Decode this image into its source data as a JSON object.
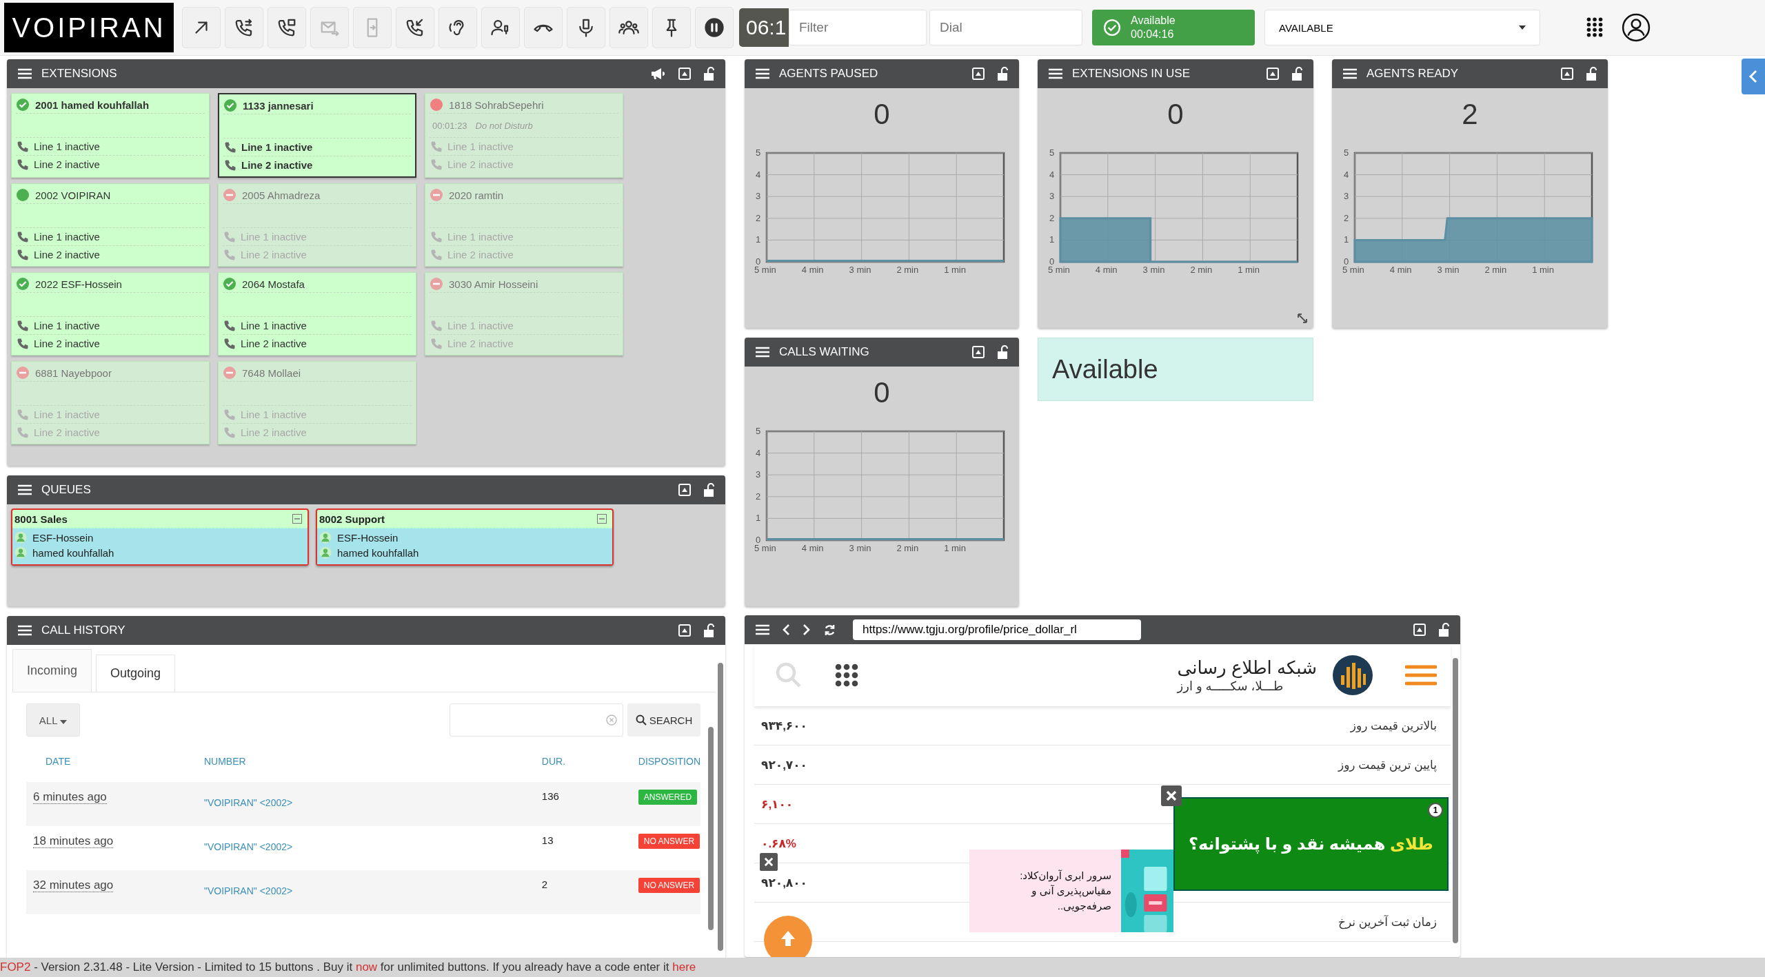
{
  "topbar": {
    "logo": "VOIPIRAN",
    "tools": [
      {
        "kind": "transfer",
        "disabled": false
      },
      {
        "kind": "forward",
        "disabled": false
      },
      {
        "kind": "voicemail",
        "disabled": false
      },
      {
        "kind": "mail",
        "disabled": true
      },
      {
        "kind": "mobile",
        "disabled": true
      },
      {
        "kind": "pickup",
        "disabled": false
      },
      {
        "kind": "listen",
        "disabled": false
      },
      {
        "kind": "whisper",
        "disabled": false
      },
      {
        "kind": "hangup",
        "disabled": false
      },
      {
        "kind": "record",
        "disabled": false
      },
      {
        "kind": "conference",
        "disabled": false
      },
      {
        "kind": "pin",
        "disabled": false
      },
      {
        "kind": "pause",
        "disabled": false
      }
    ],
    "timer": "06:1",
    "filter": {
      "placeholder": "Filter"
    },
    "dial": {
      "placeholder": "Dial"
    },
    "presence": {
      "label": "Available",
      "time": "00:04:16"
    },
    "status_select": "AVAILABLE"
  },
  "extensions": {
    "title": "EXTENSIONS",
    "cards": [
      {
        "name": "2001 hamed kouhfallah",
        "kind": "check",
        "active": true,
        "bold": true,
        "selected": false,
        "lines": [
          "Line 1 inactive",
          "Line 2 inactive"
        ]
      },
      {
        "name": "1133 jannesari",
        "kind": "check",
        "active": true,
        "bold": true,
        "selected": true,
        "lines": [
          "Line 1 inactive",
          "Line 2 inactive"
        ]
      },
      {
        "name": "1818 SohrabSepehri",
        "kind": "dot-red",
        "active": false,
        "bold": false,
        "selected": false,
        "timer": "00:01:23",
        "note": "Do not Disturb",
        "lines": [
          "Line 1 inactive",
          "Line 2 inactive"
        ]
      },
      {
        "name": "2002 VOIPIRAN",
        "kind": "dot-green",
        "active": true,
        "bold": false,
        "selected": false,
        "lines": [
          "Line 1 inactive",
          "Line 2 inactive"
        ]
      },
      {
        "name": "2005 Ahmadreza",
        "kind": "minus",
        "active": false,
        "bold": false,
        "selected": false,
        "lines": [
          "Line 1 inactive",
          "Line 2 inactive"
        ]
      },
      {
        "name": "2020 ramtin",
        "kind": "minus",
        "active": false,
        "bold": false,
        "selected": false,
        "lines": [
          "Line 1 inactive",
          "Line 2 inactive"
        ]
      },
      {
        "name": "2022 ESF-Hossein",
        "kind": "check",
        "active": true,
        "bold": false,
        "selected": false,
        "lines": [
          "Line 1 inactive",
          "Line 2 inactive"
        ]
      },
      {
        "name": "2064 Mostafa",
        "kind": "check",
        "active": true,
        "bold": false,
        "selected": false,
        "lines": [
          "Line 1 inactive",
          "Line 2 inactive"
        ]
      },
      {
        "name": "3030 Amir Hosseini",
        "kind": "minus",
        "active": false,
        "bold": false,
        "selected": false,
        "lines": [
          "Line 1 inactive",
          "Line 2 inactive"
        ]
      },
      {
        "name": "6881 Nayebpoor",
        "kind": "minus",
        "active": false,
        "bold": false,
        "selected": false,
        "lines": [
          "Line 1 inactive",
          "Line 2 inactive"
        ]
      },
      {
        "name": "7648 Mollaei",
        "kind": "minus",
        "active": false,
        "bold": false,
        "selected": false,
        "lines": [
          "Line 1 inactive",
          "Line 2 inactive"
        ]
      }
    ]
  },
  "queues": {
    "title": "QUEUES",
    "cards": [
      {
        "name": "8001 Sales",
        "members": [
          "ESF-Hossein",
          "hamed kouhfallah"
        ]
      },
      {
        "name": "8002 Support",
        "members": [
          "ESF-Hossein",
          "hamed kouhfallah"
        ]
      }
    ]
  },
  "stats": [
    {
      "title": "AGENTS PAUSED",
      "value": "0",
      "chart_data": {
        "type": "line",
        "x": [
          5,
          0
        ],
        "series": [
          {
            "color": "#5b8fa3",
            "values": [
              0,
              0
            ]
          }
        ],
        "xlim": [
          5,
          0
        ],
        "ylim": [
          0,
          5
        ],
        "xticks": [
          {
            "value": 5,
            "label": "5 min"
          },
          {
            "value": 4,
            "label": "4 min"
          },
          {
            "value": 3,
            "label": "3 min"
          },
          {
            "value": 2,
            "label": "2 min"
          },
          {
            "value": 1,
            "label": "1 min"
          }
        ],
        "yticks": [
          0,
          1,
          2,
          3,
          4,
          5
        ],
        "grid": true
      }
    },
    {
      "title": "EXTENSIONS IN USE",
      "value": "0",
      "resizable": true,
      "chart_data": {
        "type": "area",
        "x": [
          5,
          3.1,
          3.1,
          0
        ],
        "series": [
          {
            "color": "#5b8fa3",
            "values": [
              2,
              2,
              0,
              0
            ]
          }
        ],
        "xlim": [
          5,
          0
        ],
        "ylim": [
          0,
          5
        ],
        "xticks": [
          {
            "value": 5,
            "label": "5 min"
          },
          {
            "value": 4,
            "label": "4 min"
          },
          {
            "value": 3,
            "label": "3 min"
          },
          {
            "value": 2,
            "label": "2 min"
          },
          {
            "value": 1,
            "label": "1 min"
          }
        ],
        "yticks": [
          0,
          1,
          2,
          3,
          4,
          5
        ],
        "grid": true
      }
    },
    {
      "title": "AGENTS READY",
      "value": "2",
      "chart_data": {
        "type": "area",
        "x": [
          5,
          3.1,
          3.05,
          0
        ],
        "series": [
          {
            "color": "#5b8fa3",
            "values": [
              1,
              1,
              2,
              2
            ]
          }
        ],
        "xlim": [
          5,
          0
        ],
        "ylim": [
          0,
          5
        ],
        "xticks": [
          {
            "value": 5,
            "label": "5 min"
          },
          {
            "value": 4,
            "label": "4 min"
          },
          {
            "value": 3,
            "label": "3 min"
          },
          {
            "value": 2,
            "label": "2 min"
          },
          {
            "value": 1,
            "label": "1 min"
          }
        ],
        "yticks": [
          0,
          1,
          2,
          3,
          4,
          5
        ],
        "grid": true
      }
    },
    {
      "title": "CALLS WAITING",
      "value": "0",
      "chart_data": {
        "type": "line",
        "x": [
          5,
          0
        ],
        "series": [
          {
            "color": "#5b8fa3",
            "values": [
              0,
              0
            ]
          }
        ],
        "xlim": [
          5,
          0
        ],
        "ylim": [
          0,
          5
        ],
        "xticks": [
          {
            "value": 5,
            "label": "5 min"
          },
          {
            "value": 4,
            "label": "4 min"
          },
          {
            "value": 3,
            "label": "3 min"
          },
          {
            "value": 2,
            "label": "2 min"
          },
          {
            "value": 1,
            "label": "1 min"
          }
        ],
        "yticks": [
          0,
          1,
          2,
          3,
          4,
          5
        ],
        "grid": true
      }
    }
  ],
  "presence_box": {
    "text": "Available"
  },
  "call_history": {
    "title": "CALL HISTORY",
    "tabs": [
      {
        "label": "Incoming",
        "selected": true
      },
      {
        "label": "Outgoing",
        "selected": false
      }
    ],
    "filter": "ALL",
    "search_button": "SEARCH",
    "columns": [
      "DATE",
      "NUMBER",
      "DUR.",
      "DISPOSITION"
    ],
    "rows": [
      {
        "date": "6 minutes ago",
        "number": "\"VOIPIRAN\" <2002>",
        "duration": "136",
        "disposition": {
          "label": "ANSWERED",
          "kind": "answered"
        }
      },
      {
        "date": "18 minutes ago",
        "number": "\"VOIPIRAN\" <2002>",
        "duration": "13",
        "disposition": {
          "label": "NO ANSWER",
          "kind": "no-answer"
        }
      },
      {
        "date": "32 minutes ago",
        "number": "\"VOIPIRAN\" <2002>",
        "duration": "2",
        "disposition": {
          "label": "NO ANSWER",
          "kind": "no-answer"
        }
      }
    ]
  },
  "browser": {
    "url": "https://www.tgju.org/profile/price_dollar_rl",
    "site_title": "شبکه اطلاع رسانی",
    "site_subtitle": "طـــلا، سکـــــه و ارز",
    "rows": [
      {
        "label": "بالاترین قیمت روز",
        "value": "۹۳۴,۶۰۰",
        "kind": "plain"
      },
      {
        "label": "پایین ترین قیمت روز",
        "value": "۹۲۰,۷۰۰",
        "kind": "plain"
      },
      {
        "value": "۶,۱۰۰",
        "kind": "change"
      },
      {
        "value": "۰.۶۸%",
        "kind": "change"
      },
      {
        "value": "۹۲۰,۸۰۰",
        "kind": "plain"
      },
      {
        "label": "زمان ثبت آخرین نرخ",
        "kind": "plain"
      }
    ],
    "green_ad": {
      "lead": "طلای",
      "rest": " همیشه نقد و با پشتوانه؟",
      "badge": "1"
    },
    "pink_ad": {
      "lines": [
        "سرور ابری آروان‌کلاد:",
        "مقیاس‌پذیری آنی و صرفه‌جویی.."
      ]
    }
  },
  "footer": [
    {
      "text": "FOP2",
      "kind": "brand"
    },
    {
      "text": " - Version 2.31.48 - Lite Version - Limited to 15 buttons . Buy it ",
      "kind": "plain"
    },
    {
      "text": "now",
      "kind": "link"
    },
    {
      "text": " for unlimited buttons. If you already have a code enter it ",
      "kind": "plain"
    },
    {
      "text": "here",
      "kind": "link"
    }
  ]
}
